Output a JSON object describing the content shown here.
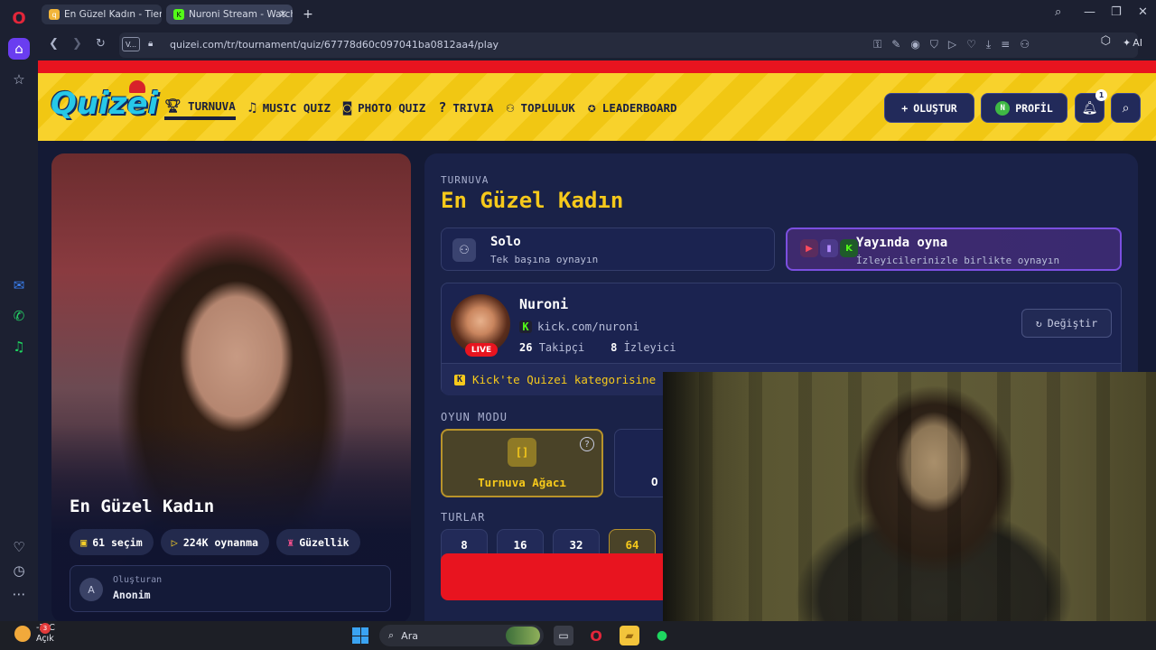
{
  "browser": {
    "tabs": [
      {
        "label": "En Güzel Kadın - Tier List"
      },
      {
        "label": "Nuroni Stream - Watch"
      }
    ],
    "url": "quizei.com/tr/tournament/quiz/67778d60c097041ba0812aa4/play",
    "v_badge": "V...",
    "ai_label": "AI"
  },
  "site": {
    "logo_text": "Quizei",
    "nav": [
      {
        "label": "TURNUVA",
        "icon": "trophy-icon"
      },
      {
        "label": "MUSIC QUIZ",
        "icon": "music-note-icon"
      },
      {
        "label": "PHOTO QUIZ",
        "icon": "camera-icon"
      },
      {
        "label": "TRIVIA",
        "icon": "question-bubble-icon"
      },
      {
        "label": "TOPLULUK",
        "icon": "users-icon"
      },
      {
        "label": "LEADERBOARD",
        "icon": "medal-icon"
      }
    ],
    "create_label": "OLUŞTUR",
    "profile_label": "PROFİL",
    "profile_initial": "N",
    "notification_count": "1"
  },
  "quiz_card": {
    "title": "En Güzel Kadın",
    "choices": "61 seçim",
    "plays": "224K oynanma",
    "category": "Güzellik",
    "creator_label": "Oluşturan",
    "creator_name": "Anonim",
    "creator_initial": "A"
  },
  "panel": {
    "eyebrow": "TURNUVA",
    "title": "En Güzel Kadın",
    "mode_solo_title": "Solo",
    "mode_solo_sub": "Tek başına oynayın",
    "mode_stream_title": "Yayında oyna",
    "mode_stream_sub": "İzleyicilerinizle birlikte oynayın",
    "streamer_name": "Nuroni",
    "streamer_link": "kick.com/nuroni",
    "followers_count": "26",
    "followers_label": "Takipçi",
    "viewers_count": "8",
    "viewers_label": "İzleyici",
    "live_label": "LIVE",
    "change_label": "Değiştir",
    "kick_note": "Kick'te Quizei kategorisine",
    "game_mode_label": "OYUN MODU",
    "game_mode_active": "Turnuva Ağacı",
    "game_mode_active_icon": "[]",
    "game_mode_other_partial": "O",
    "rounds_label": "TURLAR",
    "rounds": [
      "8",
      "16",
      "32",
      "64"
    ],
    "active_round": "64"
  },
  "taskbar": {
    "temperature": "-2°C",
    "condition": "Açık",
    "weather_badge": "3",
    "search_label": "Ara"
  },
  "colors": {
    "accent_yellow": "#f6c91b",
    "header_yellow": "#f8d22c",
    "brand_red": "#e8141f",
    "panel_navy": "#1a2248",
    "kick_green": "#53fc18",
    "stream_purple": "#7b4fe0"
  }
}
